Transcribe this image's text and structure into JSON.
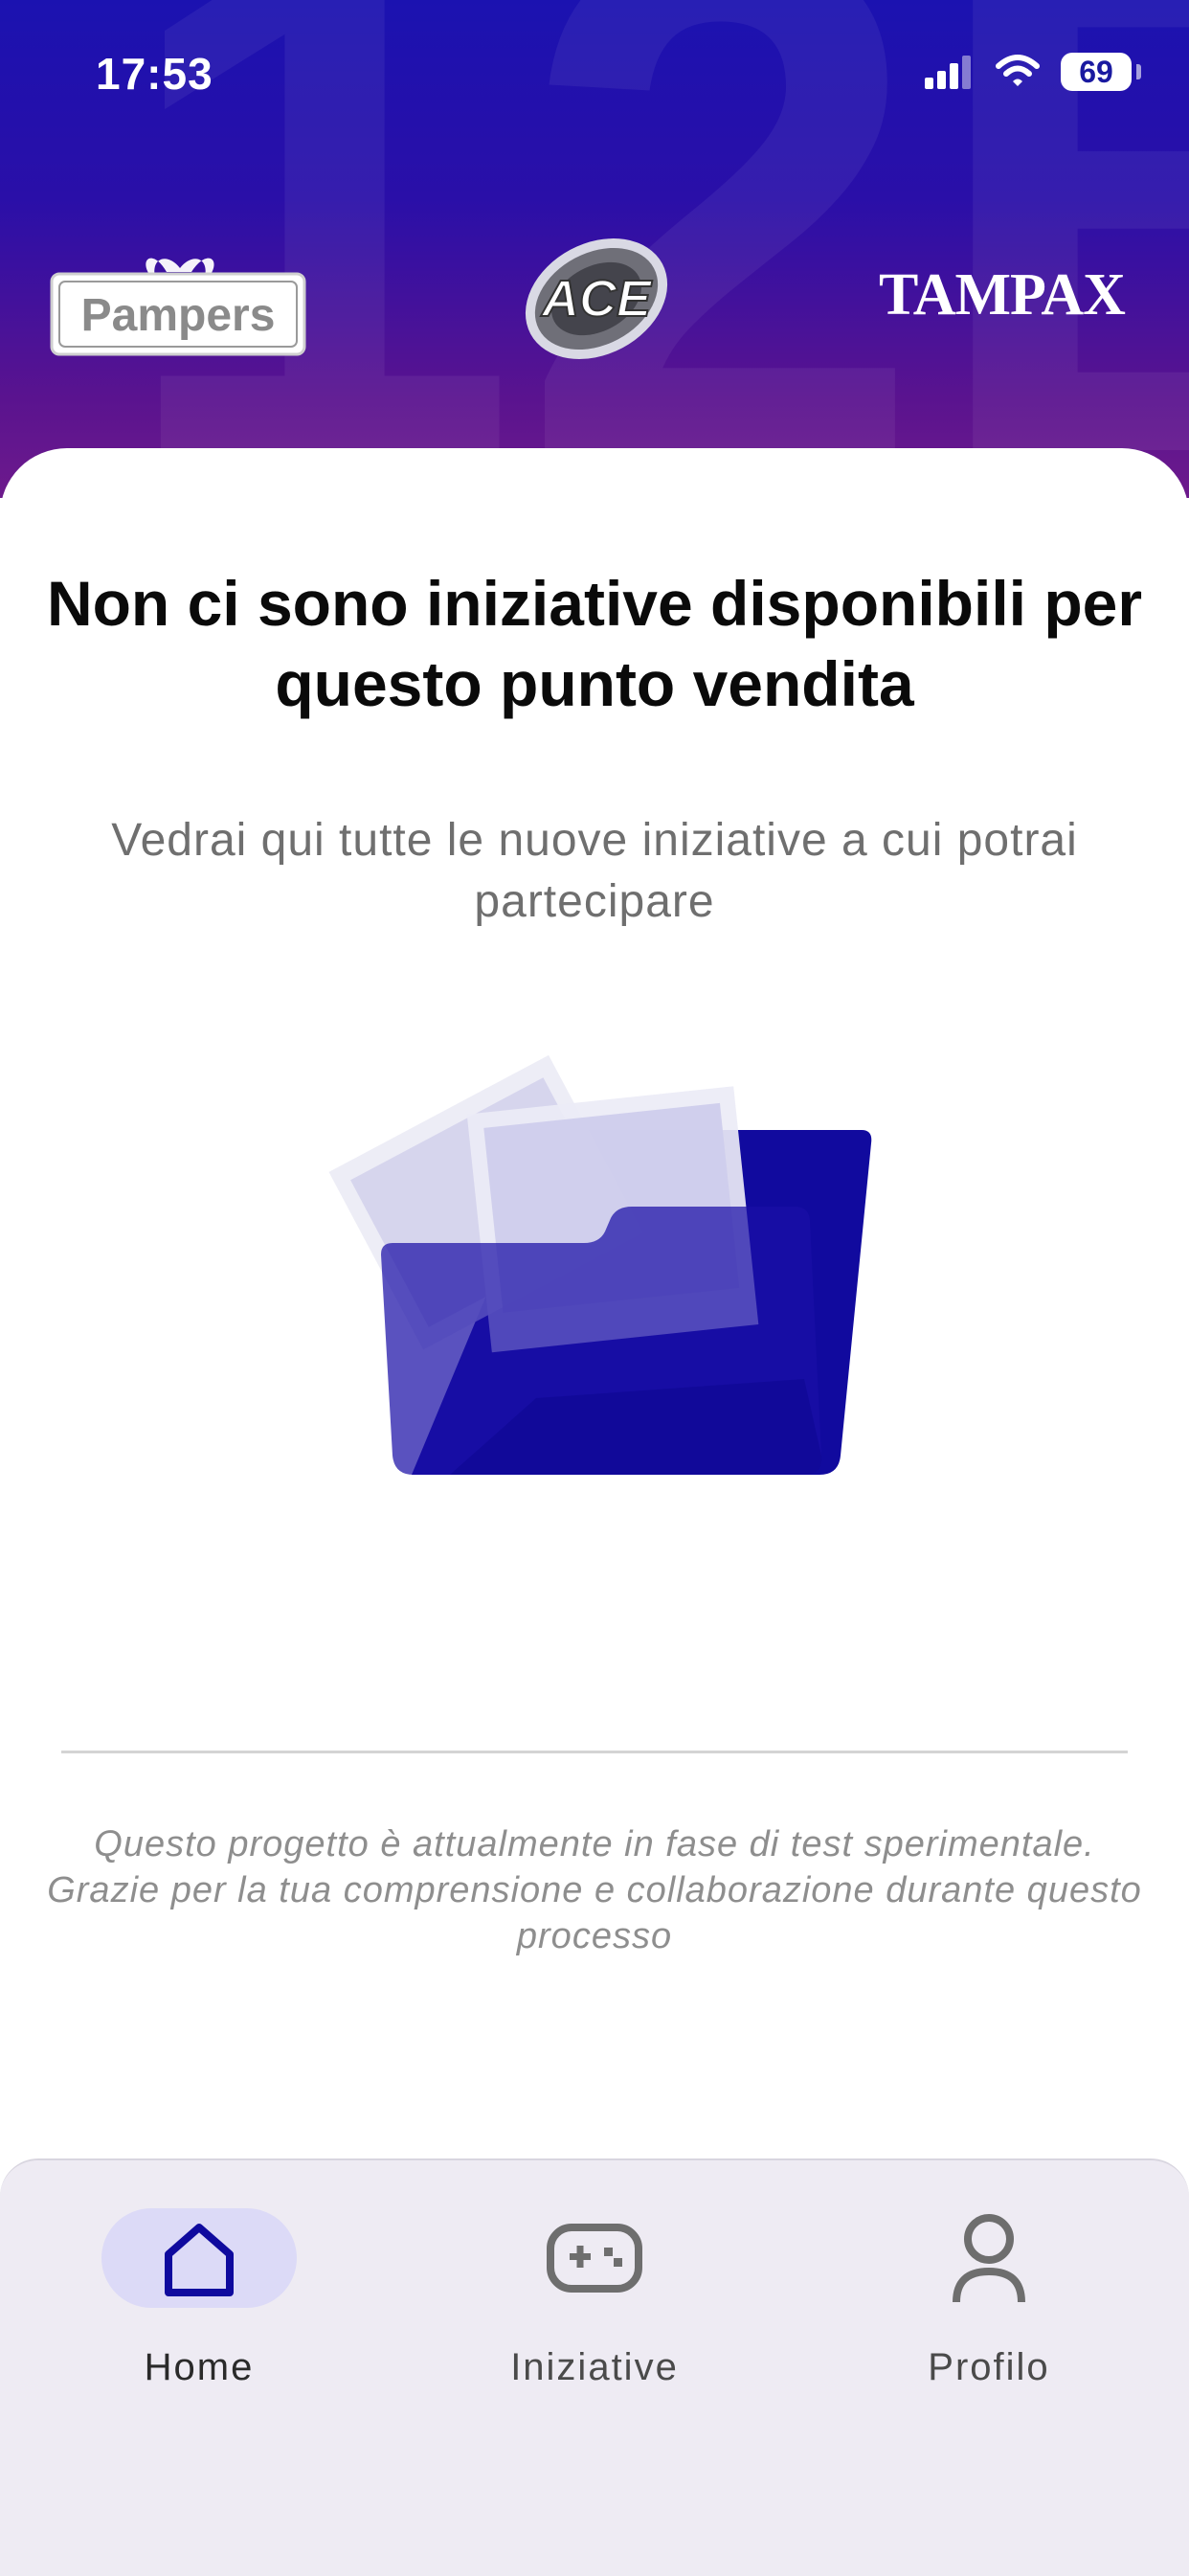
{
  "status_bar": {
    "time": "17:53",
    "battery": "69",
    "icons": [
      "signal-icon",
      "wifi-icon",
      "battery-icon"
    ]
  },
  "brands": {
    "left": "Pampers",
    "center": "ACE",
    "right": "TAMPAX"
  },
  "empty_state": {
    "title": "Non ci sono iniziative disponibili per questo punto vendita",
    "subtitle": "Vedrai qui tutte le nuove iniziative a cui potrai partecipare",
    "illustration": "empty-folder-illustration"
  },
  "footer_note": "Questo progetto è attualmente in fase di test sperimentale. Grazie per la tua comprensione e collaborazione durante questo processo",
  "bottom_nav": {
    "items": [
      {
        "label": "Home",
        "icon": "home-icon",
        "active": true
      },
      {
        "label": "Iniziative",
        "icon": "gamepad-icon",
        "active": false
      },
      {
        "label": "Profilo",
        "icon": "user-icon",
        "active": false
      }
    ]
  },
  "colors": {
    "header_top": "#1b12b0",
    "header_bottom": "#6d1a8c",
    "accent": "#0f0a9e",
    "nav_background": "#eeebf3",
    "nav_active_pill": "#dcdaf7"
  }
}
